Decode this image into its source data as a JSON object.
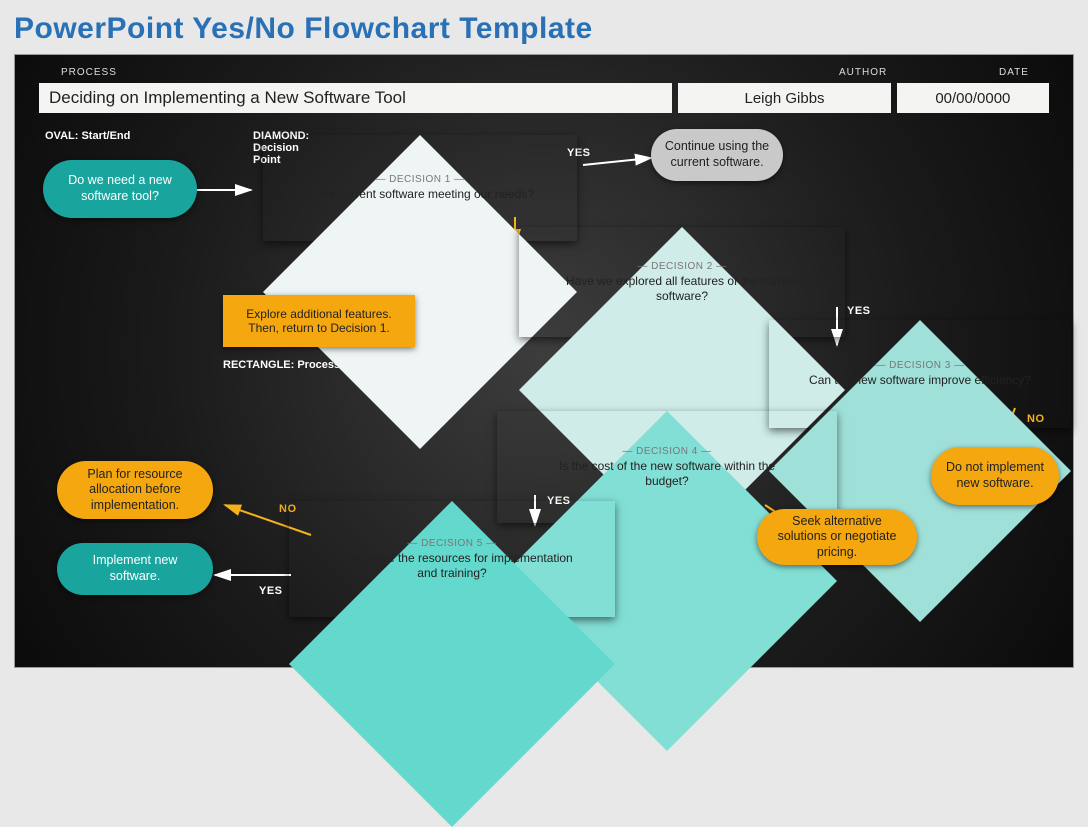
{
  "page_title": "PowerPoint Yes/No Flowchart Template",
  "header": {
    "labels": {
      "process": "PROCESS",
      "author": "AUTHOR",
      "date": "DATE"
    },
    "process_value": "Deciding on Implementing a New Software Tool",
    "author_value": "Leigh Gibbs",
    "date_value": "00/00/0000"
  },
  "legends": {
    "oval": "OVAL: Start/End",
    "diamond_1": "DIAMOND:",
    "diamond_2": "Decision",
    "diamond_3": "Point",
    "rectangle": "RECTANGLE: Process Step"
  },
  "nodes": {
    "start": "Do we need a new software tool?",
    "d1_tag": "— DECISION 1 —",
    "d1_q": "Is the current software meeting our needs?",
    "continue": "Continue using the current software.",
    "d2_tag": "— DECISION 2 —",
    "d2_q": "Have we explored all features of the current software?",
    "explore": "Explore additional features. Then, return to Decision 1.",
    "d3_tag": "— DECISION 3 —",
    "d3_q": "Can the new software improve efficiency?",
    "do_not": "Do not implement new software.",
    "d4_tag": "— DECISION 4 —",
    "d4_q": "Is the cost of the new software within the budget?",
    "seek": "Seek alternative solutions or negotiate pricing.",
    "d5_tag": "— DECISION 5 —",
    "d5_q": "Do we have the resources for implementation and training?",
    "plan": "Plan for resource allocation before implementation.",
    "implement": "Implement new software."
  },
  "labels": {
    "yes": "YES",
    "no": "NO"
  }
}
